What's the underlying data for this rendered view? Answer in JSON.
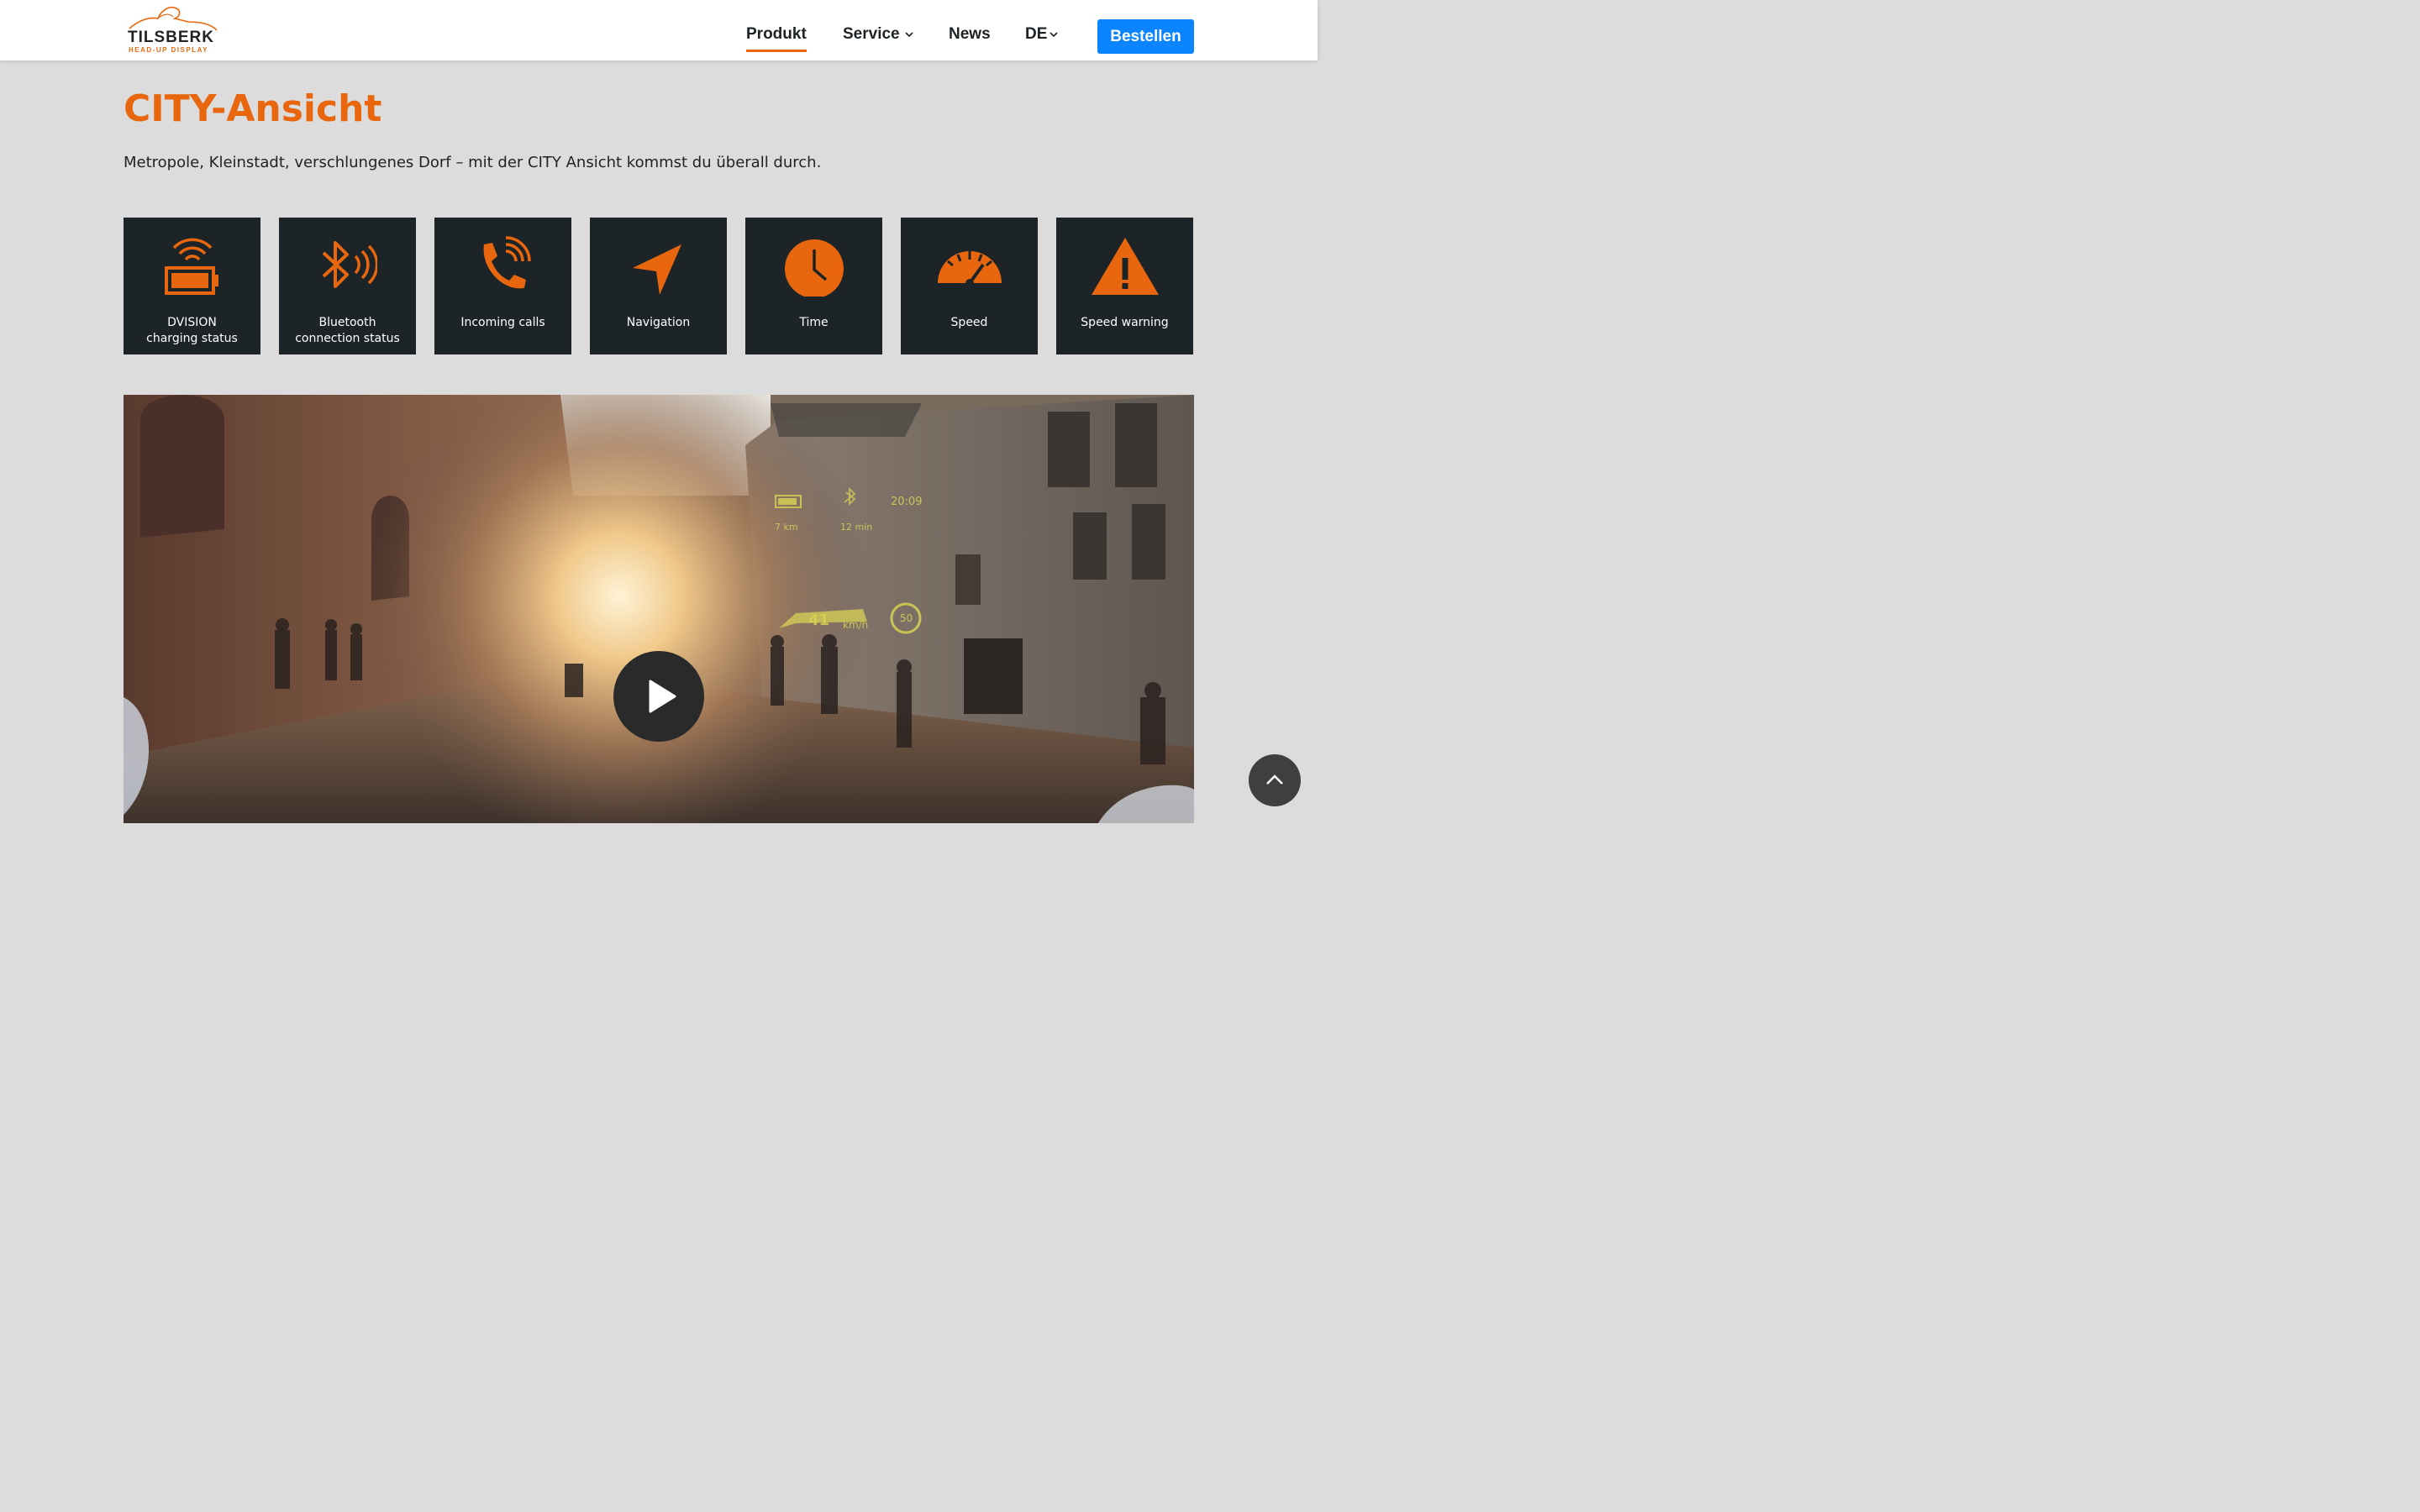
{
  "header": {
    "logo_text": "TILSBERK",
    "logo_subtitle": "HEAD-UP DISPLAY",
    "nav": [
      {
        "label": "Produkt",
        "active": true
      },
      {
        "label": "Service",
        "dropdown": true
      },
      {
        "label": "News"
      },
      {
        "label": "DE",
        "dropdown": true
      }
    ],
    "order_button": "Bestellen"
  },
  "main": {
    "title": "CITY-Ansicht",
    "intro": "Metropole, Kleinstadt, verschlungenes Dorf – mit der CITY Ansicht kommst du überall durch.",
    "features": [
      {
        "icon": "battery-wifi-icon",
        "label": "DVISION\ncharging status"
      },
      {
        "icon": "bluetooth-icon",
        "label": "Bluetooth\nconnection status"
      },
      {
        "icon": "phone-icon",
        "label": "Incoming calls"
      },
      {
        "icon": "navigation-arrow-icon",
        "label": "Navigation"
      },
      {
        "icon": "clock-icon",
        "label": "Time"
      },
      {
        "icon": "speedometer-icon",
        "label": "Speed"
      },
      {
        "icon": "warning-icon",
        "label": "Speed warning"
      }
    ]
  },
  "video": {
    "hud": {
      "time": "20:09",
      "distance": "7 km",
      "duration": "12 min",
      "speed": "41",
      "speed_unit": "km/h",
      "speed_limit": "50"
    }
  },
  "colors": {
    "accent": "#e8670e",
    "button": "#0a84ff",
    "tile_bg": "#1d2428",
    "page_bg": "#dcdcdc"
  }
}
